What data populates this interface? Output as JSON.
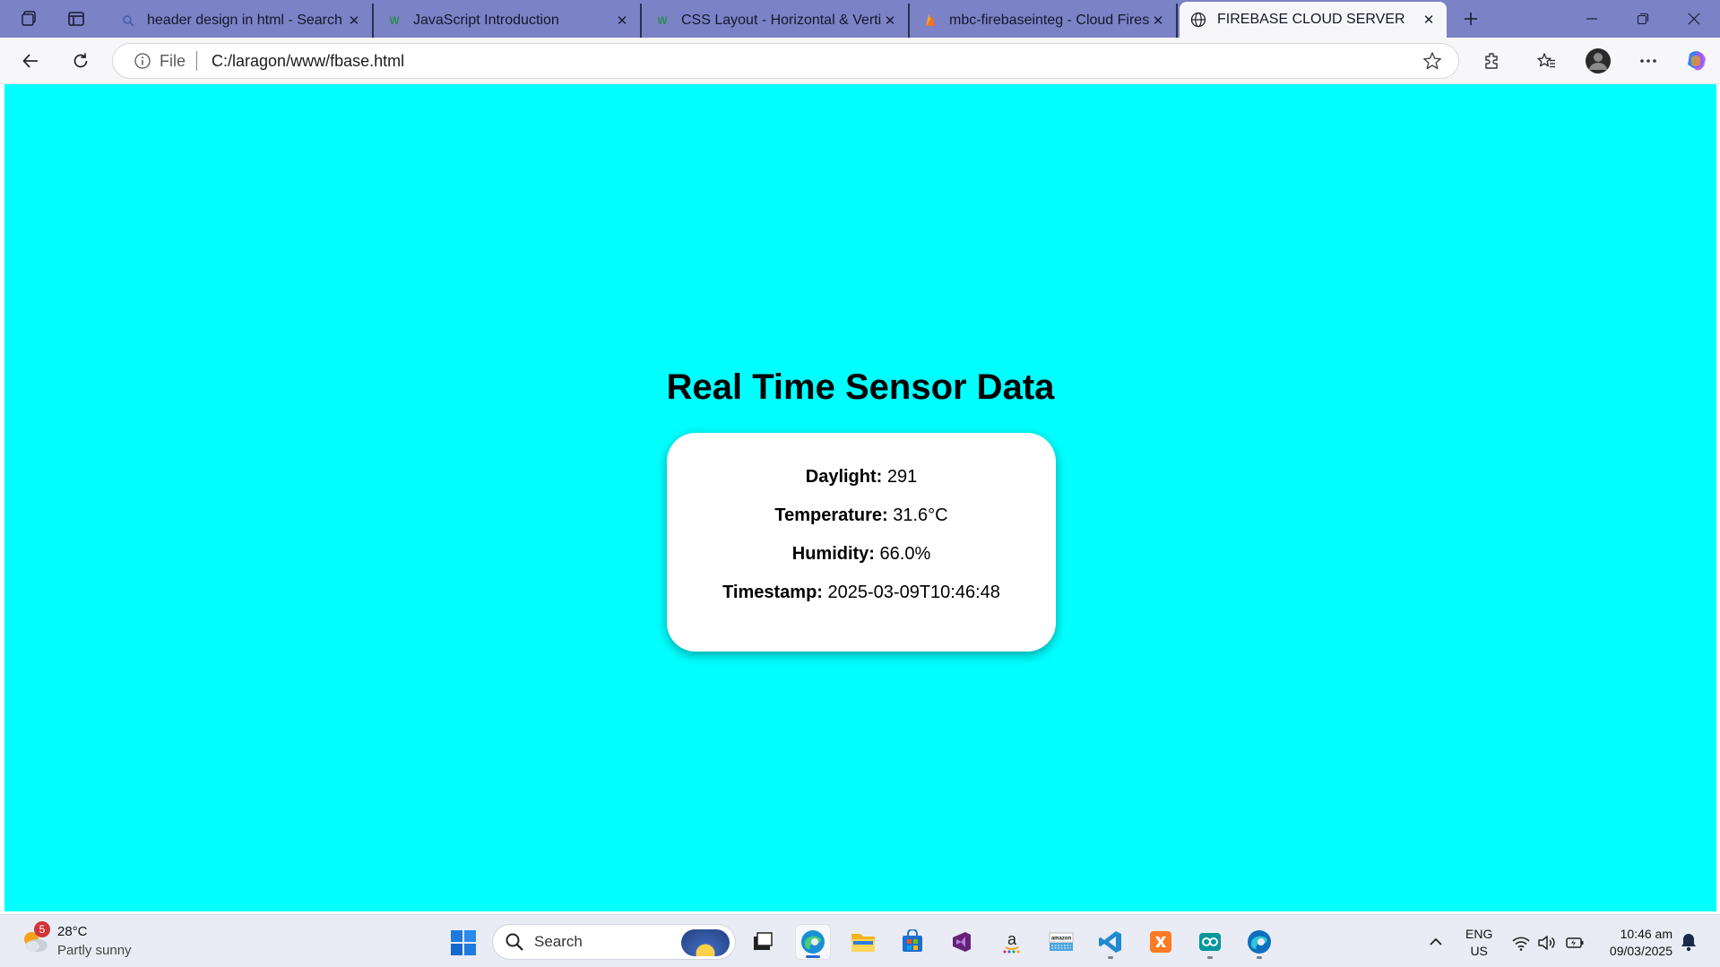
{
  "browser": {
    "tabs": [
      {
        "title": "header design in html - Search",
        "favicon": "search-icon",
        "active": false
      },
      {
        "title": "JavaScript Introduction",
        "favicon": "w3schools-icon",
        "active": false
      },
      {
        "title": "CSS Layout - Horizontal & Vertica",
        "favicon": "w3schools-icon",
        "active": false
      },
      {
        "title": "mbc-firebaseinteg - Cloud Firesto",
        "favicon": "firebase-icon",
        "active": false
      },
      {
        "title": "FIREBASE CLOUD SERVER",
        "favicon": "globe-icon",
        "active": true
      }
    ],
    "address": {
      "scheme_label": "File",
      "url": "C:/laragon/www/fbase.html"
    }
  },
  "page": {
    "background": "#00ffff",
    "heading": "Real Time Sensor Data",
    "readings": [
      {
        "label": "Daylight:",
        "value": "291"
      },
      {
        "label": "Temperature:",
        "value": "31.6°C"
      },
      {
        "label": "Humidity:",
        "value": "66.0%"
      },
      {
        "label": "Timestamp:",
        "value": "2025-03-09T10:46:48"
      }
    ]
  },
  "taskbar": {
    "weather": {
      "badge": "5",
      "temperature": "28°C",
      "condition": "Partly sunny"
    },
    "search_label": "Search",
    "language": {
      "line1": "ENG",
      "line2": "US"
    },
    "clock": {
      "time": "10:46 am",
      "date": "09/03/2025"
    }
  }
}
